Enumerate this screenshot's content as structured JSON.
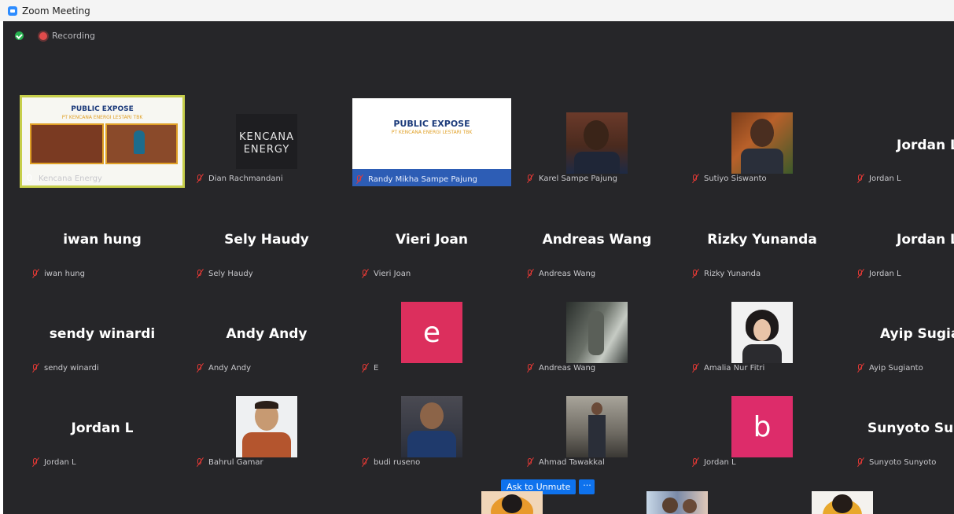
{
  "window": {
    "title": "Zoom Meeting"
  },
  "status": {
    "recording": "Recording"
  },
  "colors": {
    "accent": "#0e72ed",
    "tile_bg": "#262629",
    "active_border": "#c6ce4a",
    "avatar_pink": "#dc2f5d",
    "avatar_magenta": "#dd2c6a"
  },
  "row1": {
    "t1": {
      "slide_title": "PUBLIC EXPOSE",
      "slide_sub": "PT KENCANA ENERGI LESTARI TBK",
      "label": "Kencana Energy"
    },
    "t2": {
      "logo_line1": "KENCANA",
      "logo_line2": "ENERGY",
      "label": "Dian Rachmandani"
    },
    "t3": {
      "slide_title": "PUBLIC EXPOSE",
      "slide_sub": "PT KENCANA ENERGI LESTARI TBK",
      "label": "Randy Mikha Sampe Pajung"
    },
    "t4": {
      "label": "Karel Sampe Pajung"
    },
    "t5": {
      "label": "Sutiyo Siswanto"
    },
    "t6": {
      "name": "Jordan L",
      "label": "Jordan L"
    }
  },
  "row2": {
    "t1": {
      "name": "iwan hung",
      "label": "iwan hung"
    },
    "t2": {
      "name": "Sely Haudy",
      "label": "Sely Haudy"
    },
    "t3": {
      "name": "Vieri Joan",
      "label": "Vieri Joan"
    },
    "t4": {
      "name": "Andreas Wang",
      "label": "Andreas Wang"
    },
    "t5": {
      "name": "Rizky Yunanda",
      "label": "Rizky Yunanda"
    },
    "t6": {
      "name": "Jordan L",
      "label": "Jordan L"
    }
  },
  "row3": {
    "t1": {
      "name": "sendy winardi",
      "label": "sendy winardi"
    },
    "t2": {
      "name": "Andy Andy",
      "label": "Andy Andy"
    },
    "t3": {
      "letter": "e",
      "label": "E"
    },
    "t4": {
      "label": "Andreas Wang"
    },
    "t5": {
      "label": "Amalia Nur Fitri"
    },
    "t6": {
      "name": "Ayip Sugianto",
      "label": "Ayip Sugianto"
    }
  },
  "row4": {
    "t1": {
      "name": "Jordan L",
      "label": "Jordan L"
    },
    "t2": {
      "label": "Bahrul Gamar"
    },
    "t3": {
      "label": "budi ruseno"
    },
    "t4": {
      "label": "Ahmad Tawakkal"
    },
    "t5": {
      "letter": "b",
      "label": "Jordan L"
    },
    "t6": {
      "name": "Sunyoto Sunyoto",
      "label": "Sunyoto Sunyoto"
    }
  },
  "controls": {
    "ask_to_unmute": "Ask to Unmute",
    "more": "···"
  }
}
